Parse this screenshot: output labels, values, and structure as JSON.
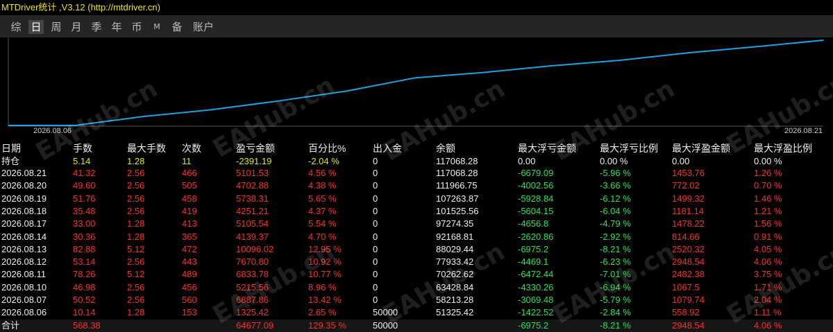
{
  "window": {
    "title": "MTDriver统计 ,V3.12 (http://mtdriver.cn)"
  },
  "tabs": [
    {
      "label": "综"
    },
    {
      "label": "日"
    },
    {
      "label": "周"
    },
    {
      "label": "月"
    },
    {
      "label": "季"
    },
    {
      "label": "年"
    },
    {
      "label": "币"
    },
    {
      "label": "M"
    },
    {
      "label": "备"
    },
    {
      "label": "账户"
    }
  ],
  "active_tab": "日",
  "chart": {
    "start_date": "2026.08.06",
    "end_date": "2026.08.21",
    "line_color": "#1aa3e6"
  },
  "chart_data": {
    "type": "line",
    "x": [
      "2026.08.06",
      "2026.08.07",
      "2026.08.10",
      "2026.08.11",
      "2026.08.12",
      "2026.08.13",
      "2026.08.14",
      "2026.08.17",
      "2026.08.18",
      "2026.08.19",
      "2026.08.20",
      "2026.08.21"
    ],
    "series": [
      {
        "values": [
          51325.42,
          58213.28,
          63428.84,
          70262.62,
          77933.42,
          88029.44,
          92168.81,
          97274.35,
          101525.56,
          107263.87,
          111966.75,
          117068.28
        ]
      }
    ]
  },
  "table": {
    "headers": [
      "日期",
      "手数",
      "最大手数",
      "次数",
      "盈亏金额",
      "百分比%",
      "出入金",
      "余额",
      "最大浮亏金额",
      "最大浮亏比例",
      "最大浮盈金额",
      "最大浮盈比例"
    ],
    "holding": [
      "持仓",
      "5.14",
      "1.28",
      "11",
      "-2391.19",
      "-2.04 %",
      "0",
      "117068.28",
      "0.00",
      "0.00 %",
      "0.00",
      "0.00 %"
    ],
    "rows": [
      [
        "2026.08.21",
        "41.32",
        "2.56",
        "466",
        "5101.53",
        "4.56 %",
        "0",
        "117068.28",
        "-6679.09",
        "-5.96 %",
        "1453.76",
        "1.26 %"
      ],
      [
        "2026.08.20",
        "49.60",
        "2.56",
        "505",
        "4702.88",
        "4.38 %",
        "0",
        "111966.75",
        "-4002.56",
        "-3.66 %",
        "772.02",
        "0.70 %"
      ],
      [
        "2026.08.19",
        "51.76",
        "2.56",
        "458",
        "5738.31",
        "5.65 %",
        "0",
        "107263.87",
        "-5928.84",
        "-6.12 %",
        "1499.32",
        "1.46 %"
      ],
      [
        "2026.08.18",
        "35.48",
        "2.56",
        "419",
        "4251.21",
        "4.37 %",
        "0",
        "101525.56",
        "-5604.15",
        "-6.04 %",
        "1181.14",
        "1.21 %"
      ],
      [
        "2026.08.17",
        "33.00",
        "1.28",
        "413",
        "5105.54",
        "5.54 %",
        "0",
        "97274.35",
        "-4656.8",
        "-4.79 %",
        "1478.22",
        "1.56 %"
      ],
      [
        "2026.08.14",
        "30.36",
        "1.28",
        "365",
        "4139.37",
        "4.70 %",
        "0",
        "92168.81",
        "-2620.86",
        "-2.92 %",
        "814.66",
        "0.91 %"
      ],
      [
        "2026.08.13",
        "82.88",
        "5.12",
        "472",
        "10096.02",
        "12.95 %",
        "0",
        "88029.44",
        "-6975.2",
        "-8.21 %",
        "2520.32",
        "4.05 %"
      ],
      [
        "2026.08.12",
        "53.14",
        "2.56",
        "443",
        "7670.80",
        "10.92 %",
        "0",
        "77933.42",
        "-4469.1",
        "-6.23 %",
        "2948.54",
        "4.06 %"
      ],
      [
        "2026.08.11",
        "78.26",
        "5.12",
        "489",
        "6833.78",
        "10.77 %",
        "0",
        "70262.62",
        "-6472.44",
        "-7.01 %",
        "2482.38",
        "3.75 %"
      ],
      [
        "2026.08.10",
        "46.98",
        "2.56",
        "456",
        "5215.56",
        "8.96 %",
        "0",
        "63428.84",
        "-4330.26",
        "-6.94 %",
        "1067.5",
        "1.71 %"
      ],
      [
        "2026.08.07",
        "50.52",
        "2.56",
        "560",
        "6887.86",
        "13.42 %",
        "0",
        "58213.28",
        "-3069.48",
        "-5.79 %",
        "1079.74",
        "2.04 %"
      ],
      [
        "2026.08.06",
        "10.14",
        "1.28",
        "153",
        "1325.42",
        "2.65 %",
        "50000",
        "51325.42",
        "-1422.52",
        "-2.84 %",
        "558.92",
        "1.11 %"
      ]
    ],
    "total": [
      "合计",
      "568.38",
      "",
      "",
      "64677.09",
      "129.35 %",
      "50000",
      "",
      "-6975.2",
      "-8.21 %",
      "2948.54",
      "4.06 %"
    ]
  },
  "watermark": {
    "text": "EAHub.cn"
  },
  "colors": {
    "title": "#f2e600",
    "positive": "#ff2c2c",
    "negative": "#1ee65a",
    "holding": "#e8e800",
    "line": "#1aa3e6"
  }
}
